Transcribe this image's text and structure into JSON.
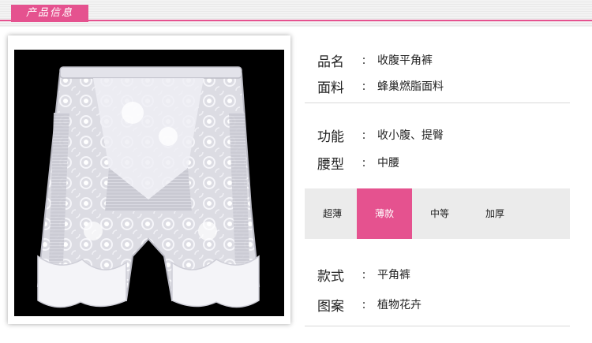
{
  "header": {
    "tag": "产品信息",
    "accent_color": "#e5528f"
  },
  "product_photo": {
    "background": "#000000",
    "garment_color": "#e8e8ee"
  },
  "specs": {
    "name": {
      "label": "品名",
      "colon": ":",
      "value": "收腹平角裤"
    },
    "fabric": {
      "label": "面料",
      "colon": ":",
      "value": "蜂巢燃脂面料"
    },
    "function": {
      "label": "功能",
      "colon": ":",
      "value": "收小腹、提臀"
    },
    "waist": {
      "label": "腰型",
      "colon": ":",
      "value": "中腰"
    },
    "style": {
      "label": "款式",
      "colon": ":",
      "value": "平角裤"
    },
    "pattern": {
      "label": "图案",
      "colon": ":",
      "value": "植物花卉"
    }
  },
  "thickness": {
    "options": [
      "超薄",
      "薄款",
      "中等",
      "加厚"
    ],
    "selected": "薄款"
  }
}
